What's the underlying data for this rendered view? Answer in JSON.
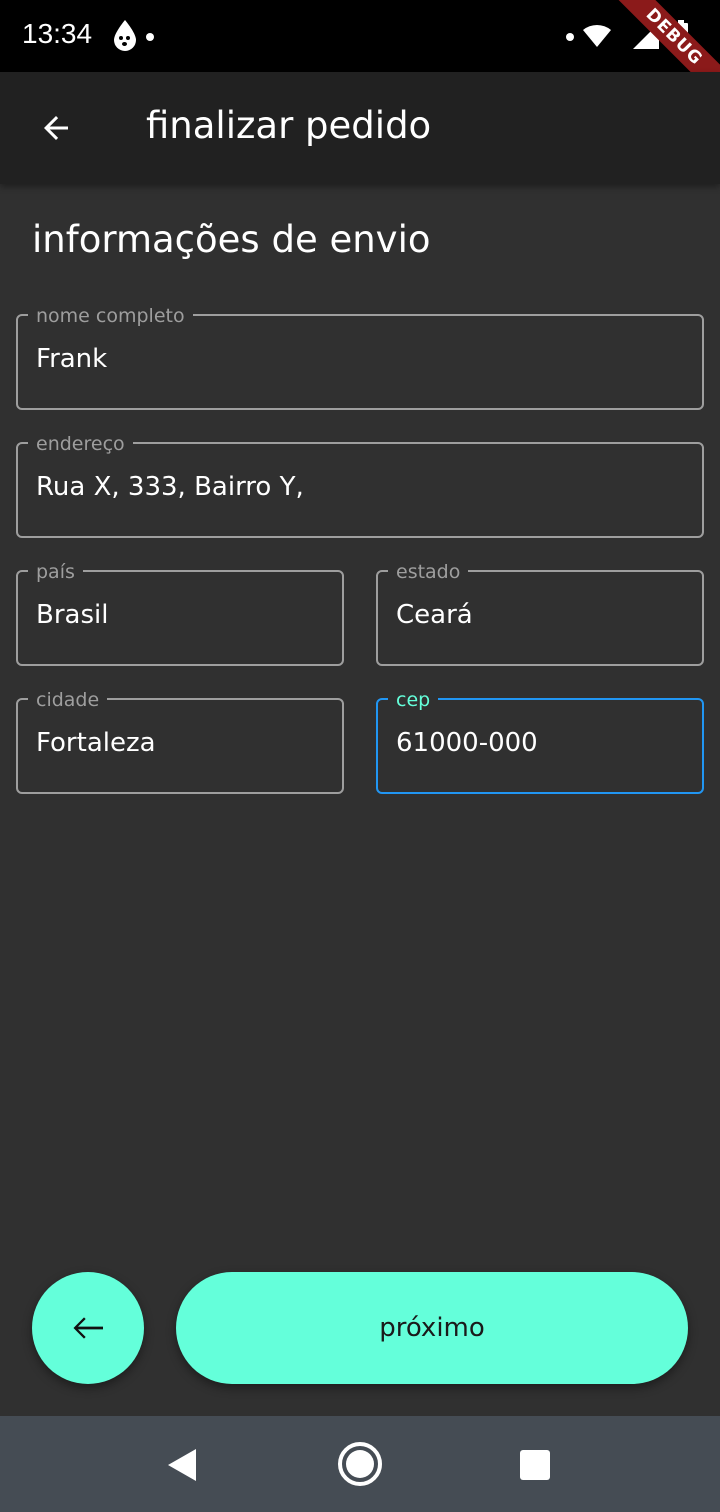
{
  "status_bar": {
    "time": "13:34",
    "debug_label": "DEBUG"
  },
  "app_bar": {
    "title": "finalizar pedido"
  },
  "section": {
    "title": "informações de envio"
  },
  "form": {
    "full_name": {
      "label": "nome completo",
      "value": "Frank"
    },
    "address": {
      "label": "endereço",
      "value": "Rua X, 333, Bairro Y,"
    },
    "country": {
      "label": "país",
      "value": "Brasil"
    },
    "state": {
      "label": "estado",
      "value": "Ceará"
    },
    "city": {
      "label": "cidade",
      "value": "Fortaleza"
    },
    "zip": {
      "label": "cep",
      "value": "61000-000",
      "focused": true
    }
  },
  "actions": {
    "next_label": "próximo"
  },
  "colors": {
    "background": "#303030",
    "app_bar": "#212121",
    "accent": "#64ffda",
    "focus_border": "#2196f3",
    "field_border": "#9e9e9e",
    "nav_bar": "#454c54"
  },
  "icons": [
    "droplet-face-icon",
    "wifi-icon",
    "signal-icon",
    "battery-icon",
    "arrow-back-icon",
    "nav-back-icon",
    "nav-home-icon",
    "nav-recents-icon"
  ]
}
